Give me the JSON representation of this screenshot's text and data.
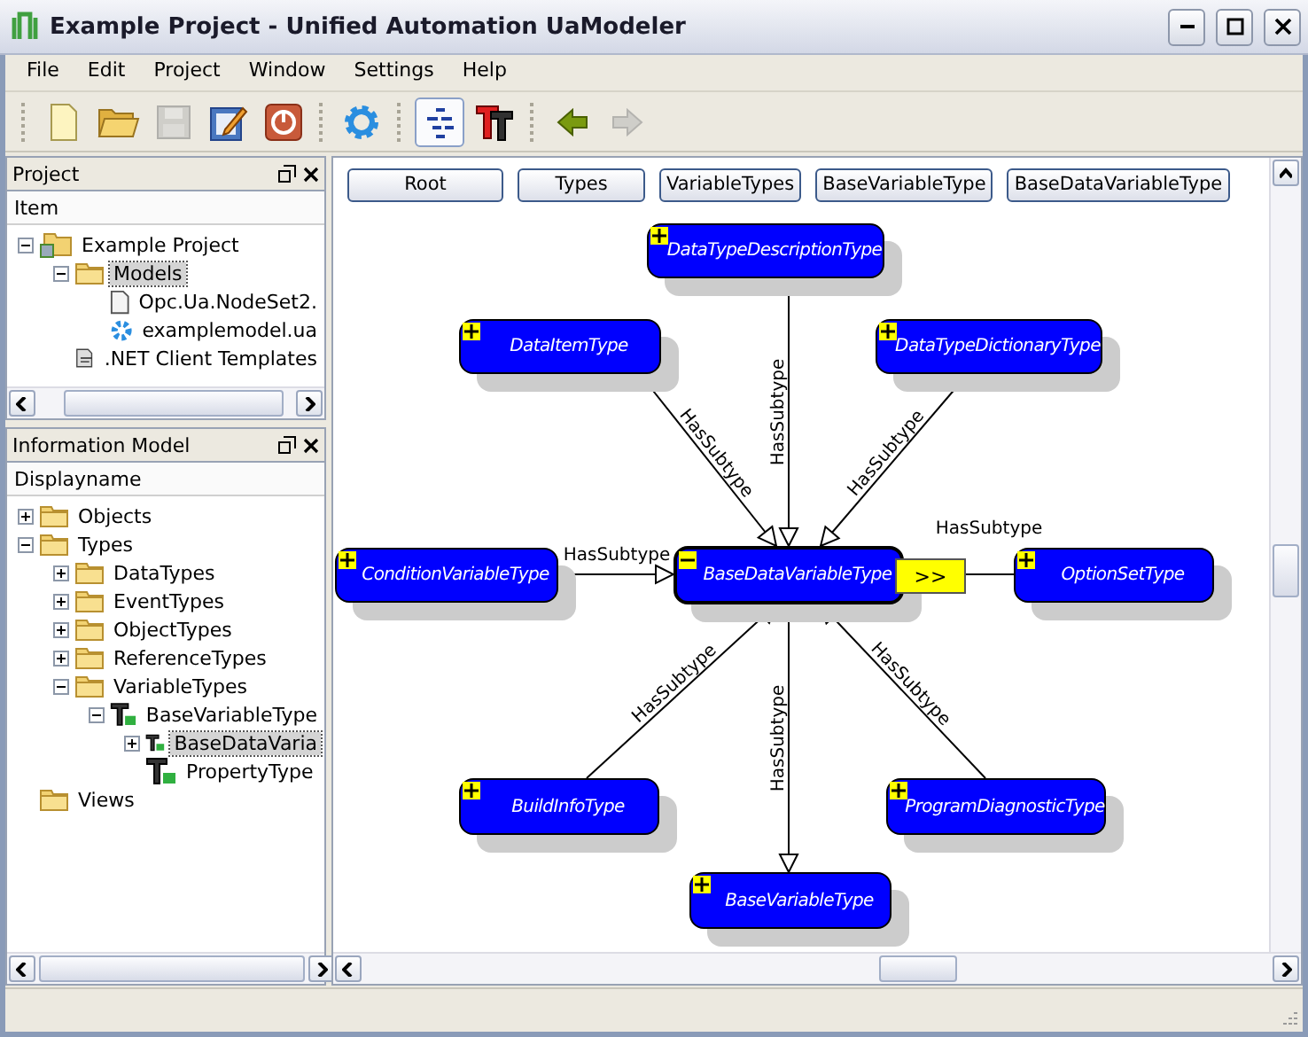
{
  "window": {
    "title": "Example Project - Unified Automation UaModeler"
  },
  "menu": [
    {
      "label": "File"
    },
    {
      "label": "Edit"
    },
    {
      "label": "Project"
    },
    {
      "label": "Window"
    },
    {
      "label": "Settings"
    },
    {
      "label": "Help"
    }
  ],
  "toolbar": [
    {
      "kind": "new",
      "disabled": false,
      "pressed": false
    },
    {
      "kind": "open",
      "disabled": false,
      "pressed": false
    },
    {
      "kind": "save",
      "disabled": true,
      "pressed": false
    },
    {
      "kind": "edit",
      "disabled": false,
      "pressed": false
    },
    {
      "kind": "power",
      "disabled": false,
      "pressed": false
    },
    {
      "kind": "gear",
      "disabled": false,
      "pressed": false
    },
    {
      "kind": "layout",
      "disabled": false,
      "pressed": true
    },
    {
      "kind": "types",
      "disabled": false,
      "pressed": false
    },
    {
      "kind": "back",
      "disabled": false,
      "pressed": false
    },
    {
      "kind": "forward",
      "disabled": true,
      "pressed": false
    }
  ],
  "project_panel": {
    "title": "Project",
    "column": "Item",
    "tree": [
      {
        "label": "Example Project",
        "kind": "project",
        "expanded": true,
        "selected": false,
        "children": [
          {
            "label": "Models",
            "kind": "folder",
            "expanded": true,
            "selected": true,
            "children": [
              {
                "label": "Opc.Ua.NodeSet2.",
                "kind": "file",
                "selected": false
              },
              {
                "label": "examplemodel.ua",
                "kind": "model",
                "selected": false
              }
            ]
          },
          {
            "label": ".NET Client Templates",
            "kind": "templates",
            "selected": false
          }
        ]
      }
    ]
  },
  "information_model_panel": {
    "title": "Information Model",
    "column": "Displayname",
    "tree": [
      {
        "label": "Objects",
        "kind": "folder",
        "expanded": false,
        "selected": false
      },
      {
        "label": "Types",
        "kind": "folder",
        "expanded": true,
        "selected": false,
        "children": [
          {
            "label": "DataTypes",
            "kind": "folder",
            "expanded": false,
            "selected": false
          },
          {
            "label": "EventTypes",
            "kind": "folder",
            "expanded": false,
            "selected": false
          },
          {
            "label": "ObjectTypes",
            "kind": "folder",
            "expanded": false,
            "selected": false
          },
          {
            "label": "ReferenceTypes",
            "kind": "folder",
            "expanded": false,
            "selected": false
          },
          {
            "label": "VariableTypes",
            "kind": "folder",
            "expanded": true,
            "selected": false,
            "children": [
              {
                "label": "BaseVariableType",
                "kind": "variable-type",
                "expanded": true,
                "selected": false,
                "children": [
                  {
                    "label": "BaseDataVaria",
                    "kind": "variable-type",
                    "expanded": false,
                    "selected": true
                  },
                  {
                    "label": "PropertyType",
                    "kind": "variable-type",
                    "selected": false
                  }
                ]
              }
            ]
          }
        ]
      },
      {
        "label": "Views",
        "kind": "folder",
        "selected": false
      }
    ]
  },
  "breadcrumbs": [
    {
      "label": "Root"
    },
    {
      "label": "Types"
    },
    {
      "label": "VariableTypes"
    },
    {
      "label": "BaseVariableType"
    },
    {
      "label": "BaseDataVariableType"
    }
  ],
  "diagram": {
    "nodes": [
      {
        "label": "DataTypeDescriptionType",
        "expanded": false,
        "selected": false
      },
      {
        "label": "DataItemType",
        "expanded": false,
        "selected": false
      },
      {
        "label": "DataTypeDictionaryType",
        "expanded": false,
        "selected": false
      },
      {
        "label": "ConditionVariableType",
        "expanded": false,
        "selected": false
      },
      {
        "label": "BaseDataVariableType",
        "expanded": true,
        "selected": true
      },
      {
        "label": "OptionSetType",
        "expanded": false,
        "selected": false
      },
      {
        "label": "BuildInfoType",
        "expanded": false,
        "selected": false
      },
      {
        "label": "ProgramDiagnosticType",
        "expanded": false,
        "selected": false
      },
      {
        "label": "BaseVariableType",
        "expanded": false,
        "selected": false
      }
    ],
    "more_button": ">>",
    "edges": [
      {
        "label": "HasSubtype"
      },
      {
        "label": "HasSubtype"
      },
      {
        "label": "HasSubtype"
      },
      {
        "label": "HasSubtype"
      },
      {
        "label": "HasSubtype"
      },
      {
        "label": "HasSubtype"
      },
      {
        "label": "HasSubtype"
      },
      {
        "label": "HasSubtype"
      }
    ]
  }
}
